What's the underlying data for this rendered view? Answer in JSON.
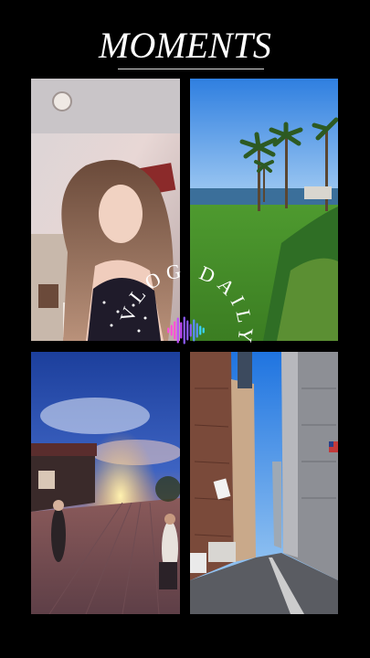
{
  "header": {
    "title": "MOMENTS"
  },
  "badge": {
    "text": "VLOG DAILY",
    "icon": "waveform-icon",
    "colors": [
      "#ff4fd8",
      "#c24bff",
      "#8e5bff",
      "#5b8dff",
      "#39d5ff"
    ]
  },
  "tiles": [
    {
      "name": "selfie-photo",
      "subject": "woman selfie in room"
    },
    {
      "name": "beach-park-photo",
      "subject": "palm trees, ocean, lawn"
    },
    {
      "name": "sunset-street-photo",
      "subject": "sunset over brick walkway"
    },
    {
      "name": "city-street-photo",
      "subject": "downtown street with skyscrapers"
    }
  ]
}
